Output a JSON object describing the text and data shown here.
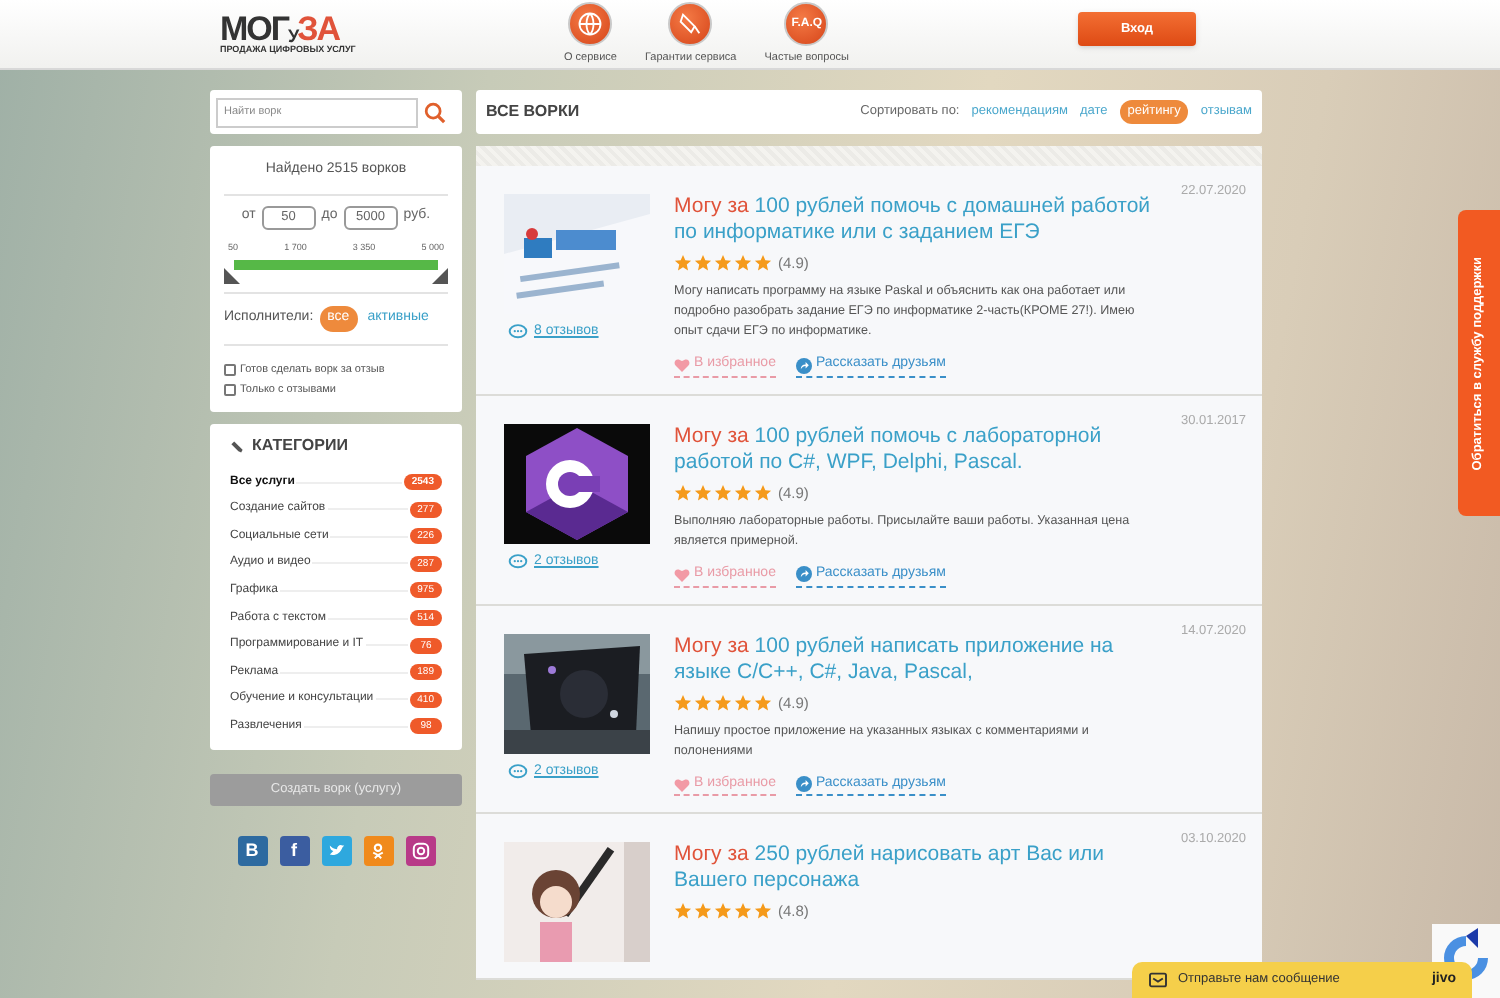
{
  "header": {
    "logo": {
      "main": "МОГ",
      "small": "У",
      "accent": "ЗА",
      "tagline": "ПРОДАЖА ЦИФРОВЫХ УСЛУГ"
    },
    "nav": [
      {
        "kind": "globe",
        "label": "О сервисе"
      },
      {
        "kind": "doc",
        "label": "Гарантии сервиса"
      },
      {
        "kind": "faq",
        "badge": "F.A.Q",
        "label": "Частые вопросы"
      }
    ],
    "login": "Вход"
  },
  "search": {
    "placeholder": "Найти ворк"
  },
  "list_header": {
    "title": "ВСЕ ВОРКИ",
    "sort_label": "Сортировать по:",
    "sort_options": [
      {
        "label": "рекомендациям",
        "selected": false
      },
      {
        "label": "дате",
        "selected": false
      },
      {
        "label": "рейтингу",
        "selected": true
      },
      {
        "label": "отзывам",
        "selected": false
      }
    ]
  },
  "filters": {
    "found": "Найдено 2515 ворков",
    "from_label": "от",
    "from": "50",
    "to_label": "до",
    "to": "5000",
    "currency": "руб.",
    "slider": {
      "ticks": [
        "50",
        "1 700",
        "3 350",
        "5 000"
      ],
      "level": 1
    },
    "performers_label": "Исполнители:",
    "performers": [
      {
        "label": "все",
        "selected": true
      },
      {
        "label": "активные",
        "selected": false
      }
    ],
    "checkboxes": [
      {
        "label": "Готов сделать ворк за отзыв",
        "checked": false
      },
      {
        "label": "Только с отзывами",
        "checked": false
      }
    ]
  },
  "categories": {
    "title": "КАТЕГОРИИ",
    "items": [
      {
        "label": "Все услуги",
        "count": "2543",
        "selected": true
      },
      {
        "label": "Создание сайтов",
        "count": "277",
        "selected": false
      },
      {
        "label": "Социальные сети",
        "count": "226",
        "selected": false
      },
      {
        "label": "Аудио и видео",
        "count": "287",
        "selected": false
      },
      {
        "label": "Графика",
        "count": "975",
        "selected": false
      },
      {
        "label": "Работа с текстом",
        "count": "514",
        "selected": false
      },
      {
        "label": "Программирование и IT",
        "count": "76",
        "selected": false
      },
      {
        "label": "Реклама",
        "count": "189",
        "selected": false
      },
      {
        "label": "Обучение и консультации",
        "count": "410",
        "selected": false
      },
      {
        "label": "Развлечения",
        "count": "98",
        "selected": false
      }
    ]
  },
  "create_button": "Создать ворк (услугу)",
  "social": [
    {
      "kind": "vk",
      "label": "В"
    },
    {
      "kind": "fb",
      "label": "f"
    },
    {
      "kind": "tw"
    },
    {
      "kind": "ok"
    },
    {
      "kind": "ig"
    }
  ],
  "cards": [
    {
      "prefix": "Могу за",
      "title": "100 рублей помочь с домашней работой по информатике или с заданием ЕГЭ",
      "stars": 5,
      "rating": "(4.9)",
      "description": "Могу написать программу на языке Paskal и объяснить как она работает или подробно разобрать задание ЕГЭ по информатике 2-часть(КРОМЕ 27!). Имею опыт сдачи ЕГЭ по информатике.",
      "reviews": "8 отзывов",
      "date": "22.07.2020",
      "favorite": "В избранное",
      "share": "Рассказать друзьям"
    },
    {
      "prefix": "Могу за",
      "title": "100 рублей помочь с лабораторной работой по C#, WPF, Delphi, Pascal.",
      "stars": 5,
      "rating": "(4.9)",
      "description": "Выполняю лабораторные работы. Присылайте ваши работы. Указанная цена является примерной.",
      "reviews": "2 отзывов",
      "date": "30.01.2017",
      "favorite": "В избранное",
      "share": "Рассказать друзьям"
    },
    {
      "prefix": "Могу за",
      "title": "100 рублей написать приложение на языке C/C++, C#, Java, Pascal,",
      "stars": 5,
      "rating": "(4.9)",
      "description": "Напишу простое приложение на указанных языках с комментариями и полонениями",
      "reviews": "2 отзывов",
      "date": "14.07.2020",
      "favorite": "В избранное",
      "share": "Рассказать друзьям"
    },
    {
      "prefix": "Могу за",
      "title": "250 рублей нарисовать арт Вас или Вашего персонажа",
      "stars": 5,
      "rating": "(4.8)",
      "date": "03.10.2020"
    }
  ],
  "support_tab": "Обратиться в службу поддержки",
  "chat": {
    "label": "Отправьте нам сообщение",
    "brand": "jivo"
  }
}
